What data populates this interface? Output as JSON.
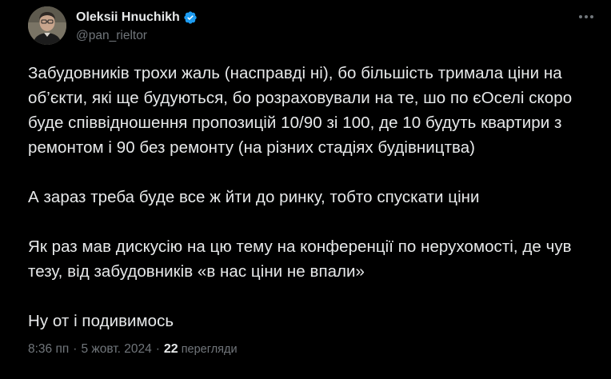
{
  "author": {
    "display_name": "Oleksii Hnuchikh",
    "handle": "@pan_rieltor",
    "verified": true
  },
  "icons": {
    "verified": "verified-badge-icon",
    "more": "more-dots-icon"
  },
  "colors": {
    "background": "#000000",
    "text_primary": "#e7e9ea",
    "text_secondary": "#71767b",
    "verified_blue": "#1d9bf0"
  },
  "tweet": {
    "paragraphs": [
      "Забудовників трохи жаль (насправді ні), бо більшість тримала ціни на об’єкти, які ще будуються, бо розраховували на те, шо по єОселі скоро буде співвідношення пропозицій 10/90 зі 100, де 10 будуть квартири з ремонтом і 90 без ремонту (на різних стадіях будівництва)",
      "А зараз треба буде все ж йти до ринку, тобто спускати ціни",
      "Як раз мав дискусію на цю тему на конференції по нерухомості, де чув тезу, від забудовників «в нас ціни не впали»",
      "Ну от і подивимось"
    ]
  },
  "meta": {
    "time": "8:36 пп",
    "separator": "·",
    "date": "5 жовт. 2024",
    "views_count": "22",
    "views_label": "перегляди"
  }
}
